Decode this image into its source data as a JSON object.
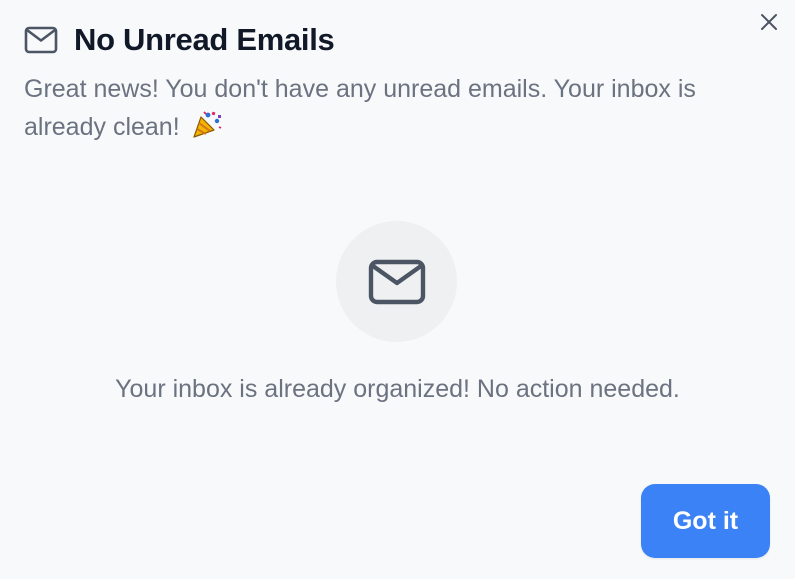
{
  "dialog": {
    "title": "No Unread Emails",
    "description": "Great news! You don't have any unread emails. Your inbox is already clean!",
    "center_message": "Your inbox is already organized! No action needed.",
    "primary_button_label": "Got it",
    "close_label": "Close"
  },
  "icons": {
    "header": "mail-icon",
    "celebration": "party-popper-icon",
    "center": "mail-icon",
    "close": "close-icon"
  },
  "colors": {
    "background": "#f8f9fb",
    "title": "#111827",
    "body_text": "#6b7280",
    "icon_gray": "#4b5563",
    "circle_bg": "#eff0f2",
    "button_bg": "#3b82f6",
    "button_text": "#ffffff"
  }
}
